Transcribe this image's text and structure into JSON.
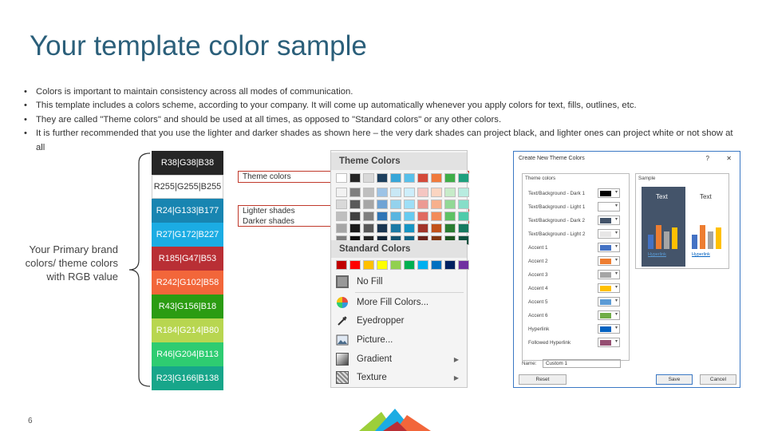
{
  "slide": {
    "title": "Your template color sample",
    "bullets": [
      "Colors is important to maintain consistency across all modes of communication.",
      "This template includes a colors scheme, according to your company. It will come up automatically whenever you apply colors for text, fills, outlines, etc.",
      "They are called \"Theme colors\" and should be used at all times, as opposed to \"Standard colors\" or any other colors.",
      "It is further recommended that you use the lighter and darker shades as shown here – the very dark shades can project black, and lighter ones can project white or not show at all"
    ],
    "primary_label": "Your Primary brand colors/ theme colors with RGB value",
    "page_number": "6"
  },
  "swatches": [
    {
      "label": "R38|G38|B38",
      "bg": "#262626",
      "fg": "#ffffff"
    },
    {
      "label": "R255|G255|B255",
      "bg": "#ffffff",
      "fg": "#333333"
    },
    {
      "label": "R24|G133|B177",
      "bg": "#1885b1",
      "fg": "#ffffff"
    },
    {
      "label": "R27|G172|B227",
      "bg": "#1bace3",
      "fg": "#ffffff"
    },
    {
      "label": "R185|G47|B53",
      "bg": "#b92f35",
      "fg": "#ffffff"
    },
    {
      "label": "R242|G102|B58",
      "bg": "#f2663a",
      "fg": "#ffffff"
    },
    {
      "label": "R43|G156|B18",
      "bg": "#2b9c12",
      "fg": "#ffffff"
    },
    {
      "label": "R184|G214|B80",
      "bg": "#b8d650",
      "fg": "#ffffff"
    },
    {
      "label": "R46|G204|B113",
      "bg": "#2ecc71",
      "fg": "#ffffff"
    },
    {
      "label": "R23|G166|B138",
      "bg": "#17a68a",
      "fg": "#ffffff"
    }
  ],
  "annotations": {
    "theme_colors": "Theme colors",
    "lighter_shades": "Lighter shades",
    "darker_shades": "Darker shades"
  },
  "picker": {
    "theme_header": "Theme Colors",
    "standard_header": "Standard Colors",
    "theme_row": [
      "#ffffff",
      "#262626",
      "#d9d9d9",
      "#1d3f5e",
      "#38a6d8",
      "#58c0ea",
      "#d44a3a",
      "#f07a3c",
      "#3fae49",
      "#1fa07e"
    ],
    "light_rows": [
      [
        "#f2f2f2",
        "#7f7f7f",
        "#bfbfbf",
        "#9dc3e6",
        "#c9e8f5",
        "#cdeefb",
        "#f5c6c2",
        "#fbd5c1",
        "#c7ebc9",
        "#b8ece0"
      ],
      [
        "#d9d9d9",
        "#595959",
        "#a6a6a6",
        "#6fa3d4",
        "#94d2ed",
        "#9edff7",
        "#ec9a93",
        "#f7b08c",
        "#92d896",
        "#86dec8"
      ],
      [
        "#bfbfbf",
        "#404040",
        "#7f7f7f",
        "#2e75b6",
        "#58b5e0",
        "#66cbf0",
        "#e06a60",
        "#f38b59",
        "#5ec264",
        "#4fcbaa"
      ]
    ],
    "dark_rows": [
      [
        "#a6a6a6",
        "#1a1a1a",
        "#595959",
        "#1a3652",
        "#1c7aa6",
        "#1795c4",
        "#a2342a",
        "#c2521a",
        "#2a7d32",
        "#177a60"
      ],
      [
        "#7f7f7f",
        "#0d0d0d",
        "#262626",
        "#112436",
        "#135270",
        "#0f6384",
        "#6c231c",
        "#823711",
        "#1c5421",
        "#0f5240"
      ]
    ],
    "standard_row": [
      "#c00000",
      "#ff0000",
      "#ffc000",
      "#ffff00",
      "#92d050",
      "#00b050",
      "#00b0f0",
      "#0070c0",
      "#002060",
      "#7030a0"
    ],
    "menu": {
      "no_fill": "No Fill",
      "more_fill": "More Fill Colors...",
      "eyedropper": "Eyedropper",
      "picture": "Picture...",
      "gradient": "Gradient",
      "texture": "Texture"
    }
  },
  "dialog": {
    "title": "Create New Theme Colors",
    "help": "?",
    "close": "✕",
    "theme_colors_label": "Theme colors",
    "sample_label": "Sample",
    "rows": [
      {
        "label": "Text/Background - Dark 1",
        "color": "#000000"
      },
      {
        "label": "Text/Background - Light 1",
        "color": "#ffffff"
      },
      {
        "label": "Text/Background - Dark 2",
        "color": "#44546a"
      },
      {
        "label": "Text/Background - Light 2",
        "color": "#e7e6e6"
      },
      {
        "label": "Accent 1",
        "color": "#4472c4"
      },
      {
        "label": "Accent 2",
        "color": "#ed7d31"
      },
      {
        "label": "Accent 3",
        "color": "#a5a5a5"
      },
      {
        "label": "Accent 4",
        "color": "#ffc000"
      },
      {
        "label": "Accent 5",
        "color": "#5b9bd5"
      },
      {
        "label": "Accent 6",
        "color": "#70ad47"
      },
      {
        "label": "Hyperlink",
        "color": "#0563c1"
      },
      {
        "label": "Followed Hyperlink",
        "color": "#954f72"
      }
    ],
    "sample_text": "Text",
    "sample_hyperlink": "Hyperlink",
    "name_label": "Name:",
    "name_value": "Custom 1",
    "reset": "Reset",
    "save": "Save",
    "cancel": "Cancel",
    "bar_colors": [
      "#4472c4",
      "#ed7d31",
      "#a5a5a5",
      "#ffc000"
    ]
  }
}
